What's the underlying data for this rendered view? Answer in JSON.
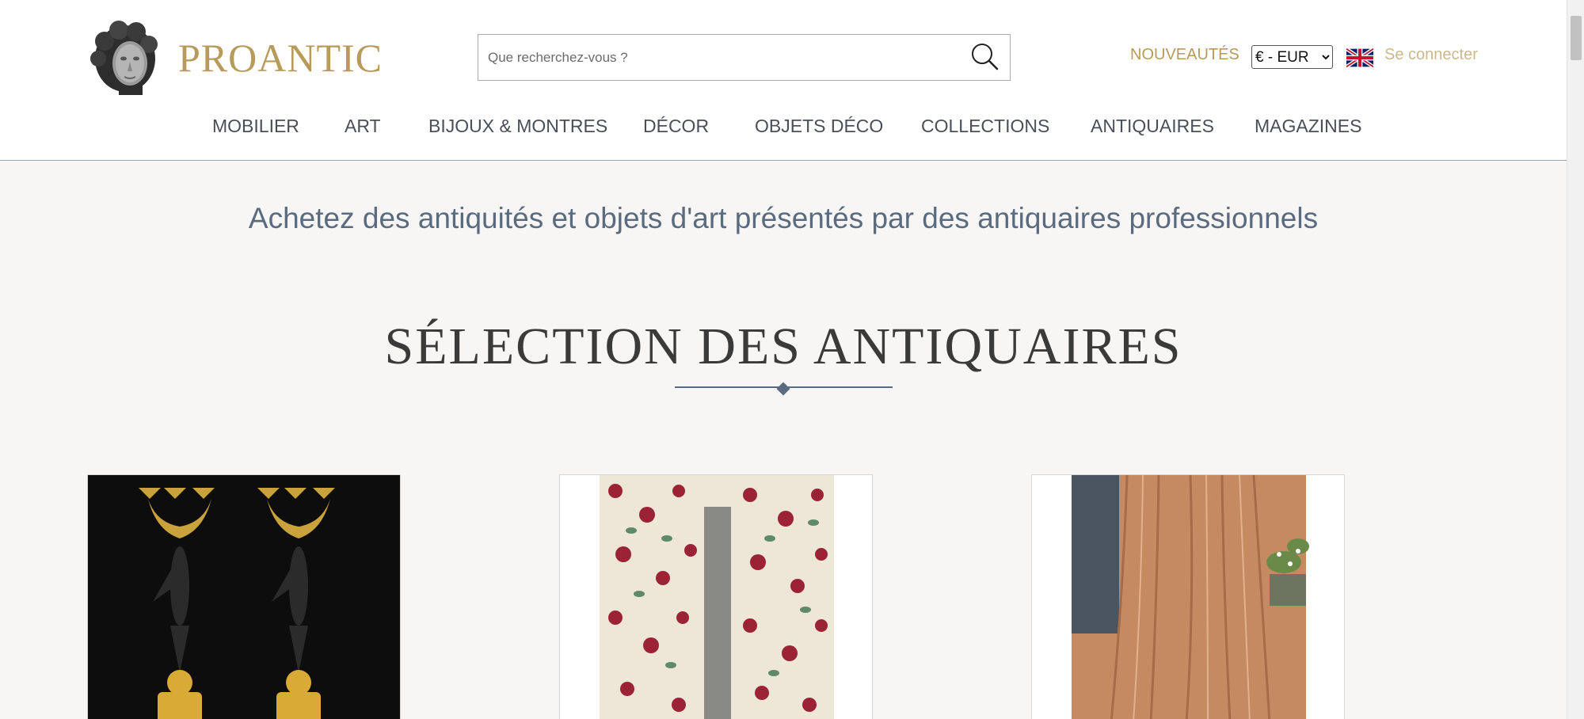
{
  "header": {
    "logo_text": "PROANTIC",
    "search_placeholder": "Que recherchez-vous ?",
    "new_label": "NOUVEAUTÉS",
    "currency": {
      "selected": "€ - EUR",
      "options": [
        "€ - EUR"
      ]
    },
    "language_icon": "uk-flag-icon",
    "login_label": "Se connecter",
    "nav": [
      "MOBILIER",
      "ART",
      "BIJOUX & MONTRES",
      "DÉCOR",
      "OBJETS DÉCO",
      "COLLECTIONS",
      "ANTIQUAIRES",
      "MAGAZINES"
    ]
  },
  "main": {
    "tagline": "Achetez des antiquités et objets d'art présentés par des antiquaires professionnels",
    "section_title": "SÉLECTION DES ANTIQUAIRES",
    "cards": [
      {
        "image": "bronze-candelabra-pair"
      },
      {
        "image": "floral-curtains"
      },
      {
        "image": "silk-curtains"
      }
    ]
  },
  "colors": {
    "brand_gold": "#b89a5a",
    "accent_blue": "#5a6b80",
    "background": "#f7f6f4"
  }
}
